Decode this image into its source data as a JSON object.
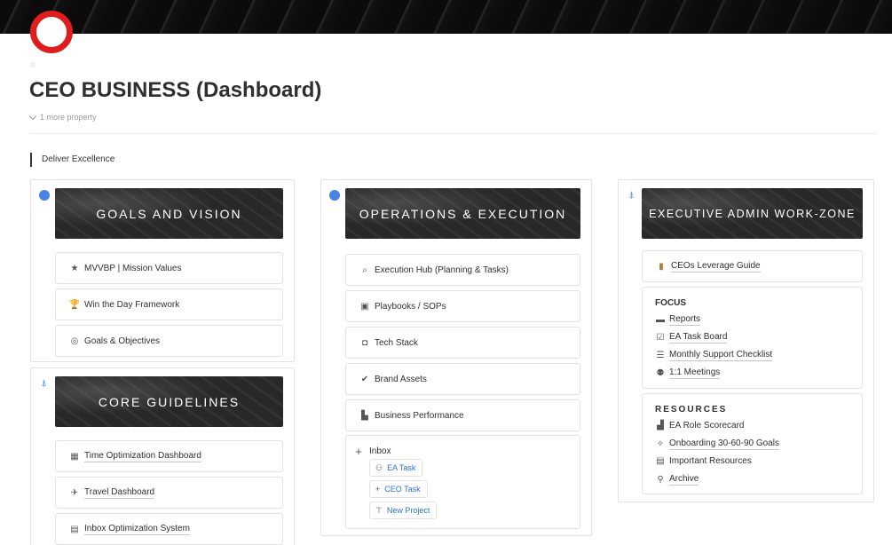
{
  "page": {
    "title": "CEO BUSINESS (Dashboard)",
    "more_property": "1 more property",
    "quote": "Deliver Excellence"
  },
  "columns": [
    {
      "sections": [
        {
          "banner": "GOALS AND VISION",
          "icon": "badge-icon",
          "links": [
            {
              "label": "MVVBP | Mission Values",
              "icon": "star-icon"
            },
            {
              "label": "Win the Day Framework",
              "icon": "trophy-icon"
            },
            {
              "label": "Goals & Objectives",
              "icon": "target-icon"
            }
          ]
        },
        {
          "banner": "CORE GUIDELINES",
          "icon": "person-up-icon",
          "links": [
            {
              "label": "Time Optimization Dashboard",
              "icon": "calendar-icon"
            },
            {
              "label": "Travel Dashboard",
              "icon": "airplane-icon"
            },
            {
              "label": "Inbox Optimization System",
              "icon": "inbox-icon"
            }
          ]
        }
      ]
    },
    {
      "sections": [
        {
          "banner": "OPERATIONS & EXECUTION",
          "icon": "badge-icon",
          "links": [
            {
              "label": "Execution Hub (Planning & Tasks)",
              "icon": "search-gear-icon"
            },
            {
              "label": "Playbooks / SOPs",
              "icon": "book-icon"
            },
            {
              "label": "Tech Stack",
              "icon": "robot-icon"
            },
            {
              "label": "Brand Assets",
              "icon": "verified-icon"
            },
            {
              "label": "Business Performance",
              "icon": "chart-icon"
            }
          ],
          "inbox": {
            "label": "Inbox",
            "icon": "plus-icon",
            "chips": [
              {
                "label": "EA Task",
                "icon": "add-person-icon"
              },
              {
                "label": "CEO Task",
                "icon": "plus-icon"
              },
              {
                "label": "New Project",
                "icon": "signpost-icon"
              }
            ]
          }
        }
      ]
    },
    {
      "sections": [
        {
          "banner": "EXECUTIVE ADMIN WORK-ZONE",
          "icon": "person-up-icon",
          "leverage": {
            "label": "CEOs Leverage Guide",
            "icon": "scroll-icon"
          },
          "focus": {
            "heading": "FOCUS",
            "items": [
              {
                "label": "Reports",
                "icon": "document-icon"
              },
              {
                "label": "EA Task Board",
                "icon": "checkbox-icon"
              },
              {
                "label": "Monthly Support Checklist",
                "icon": "checklist-icon"
              },
              {
                "label": "1:1 Meetings",
                "icon": "people-icon"
              }
            ]
          },
          "resources": {
            "heading": "RESOURCES",
            "items": [
              {
                "label": "EA Role Scorecard",
                "icon": "bars-icon"
              },
              {
                "label": "Onboarding 30-60-90 Goals",
                "icon": "sparkle-icon"
              },
              {
                "label": "Important Resources",
                "icon": "archive-box-icon"
              },
              {
                "label": "Archive",
                "icon": "archive-person-icon"
              }
            ]
          }
        }
      ]
    }
  ],
  "colors": {
    "accent_blue": "#4a82e6",
    "link_blue": "#2f6fca",
    "logo_red": "#e01d1d",
    "border": "#e3e2e0"
  }
}
